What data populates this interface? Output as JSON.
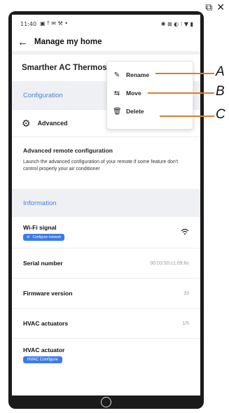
{
  "status_bar": {
    "time": "11:40",
    "left_icons": "▣ ⤒ ✉ ⚒ •",
    "right_icons": "✱ ⊠ ◐ ⁝ ▼ ▮"
  },
  "header": {
    "title": "Manage my home"
  },
  "device": {
    "name": "Smarther AC Thermostat"
  },
  "configuration": {
    "heading": "Configuration",
    "advanced_label": "Advanced"
  },
  "remote": {
    "title": "Advanced remote configuration",
    "description": "Launch the advanced configuration of your remote if some feature don't control properly your air conditioner"
  },
  "information": {
    "heading": "Information",
    "wifi": {
      "label": "Wi-Fi signal",
      "button": "Configure network"
    },
    "serial": {
      "label": "Serial number",
      "value": "00:03:50:c1:09:6c"
    },
    "firmware": {
      "label": "Firmware version",
      "value": "33"
    },
    "actuators": {
      "label": "HVAC actuators",
      "value": "1/5"
    },
    "actuator": {
      "label": "HVAC actuator",
      "button": "HVAC Configure"
    }
  },
  "menu": {
    "rename": "Rename",
    "move": "Move",
    "delete": "Delete"
  },
  "callouts": {
    "a": "A",
    "b": "B",
    "c": "C"
  },
  "colors": {
    "accent": "#3d7be6",
    "callout_line": "#e07a28",
    "section_text": "#4a7fd6"
  }
}
